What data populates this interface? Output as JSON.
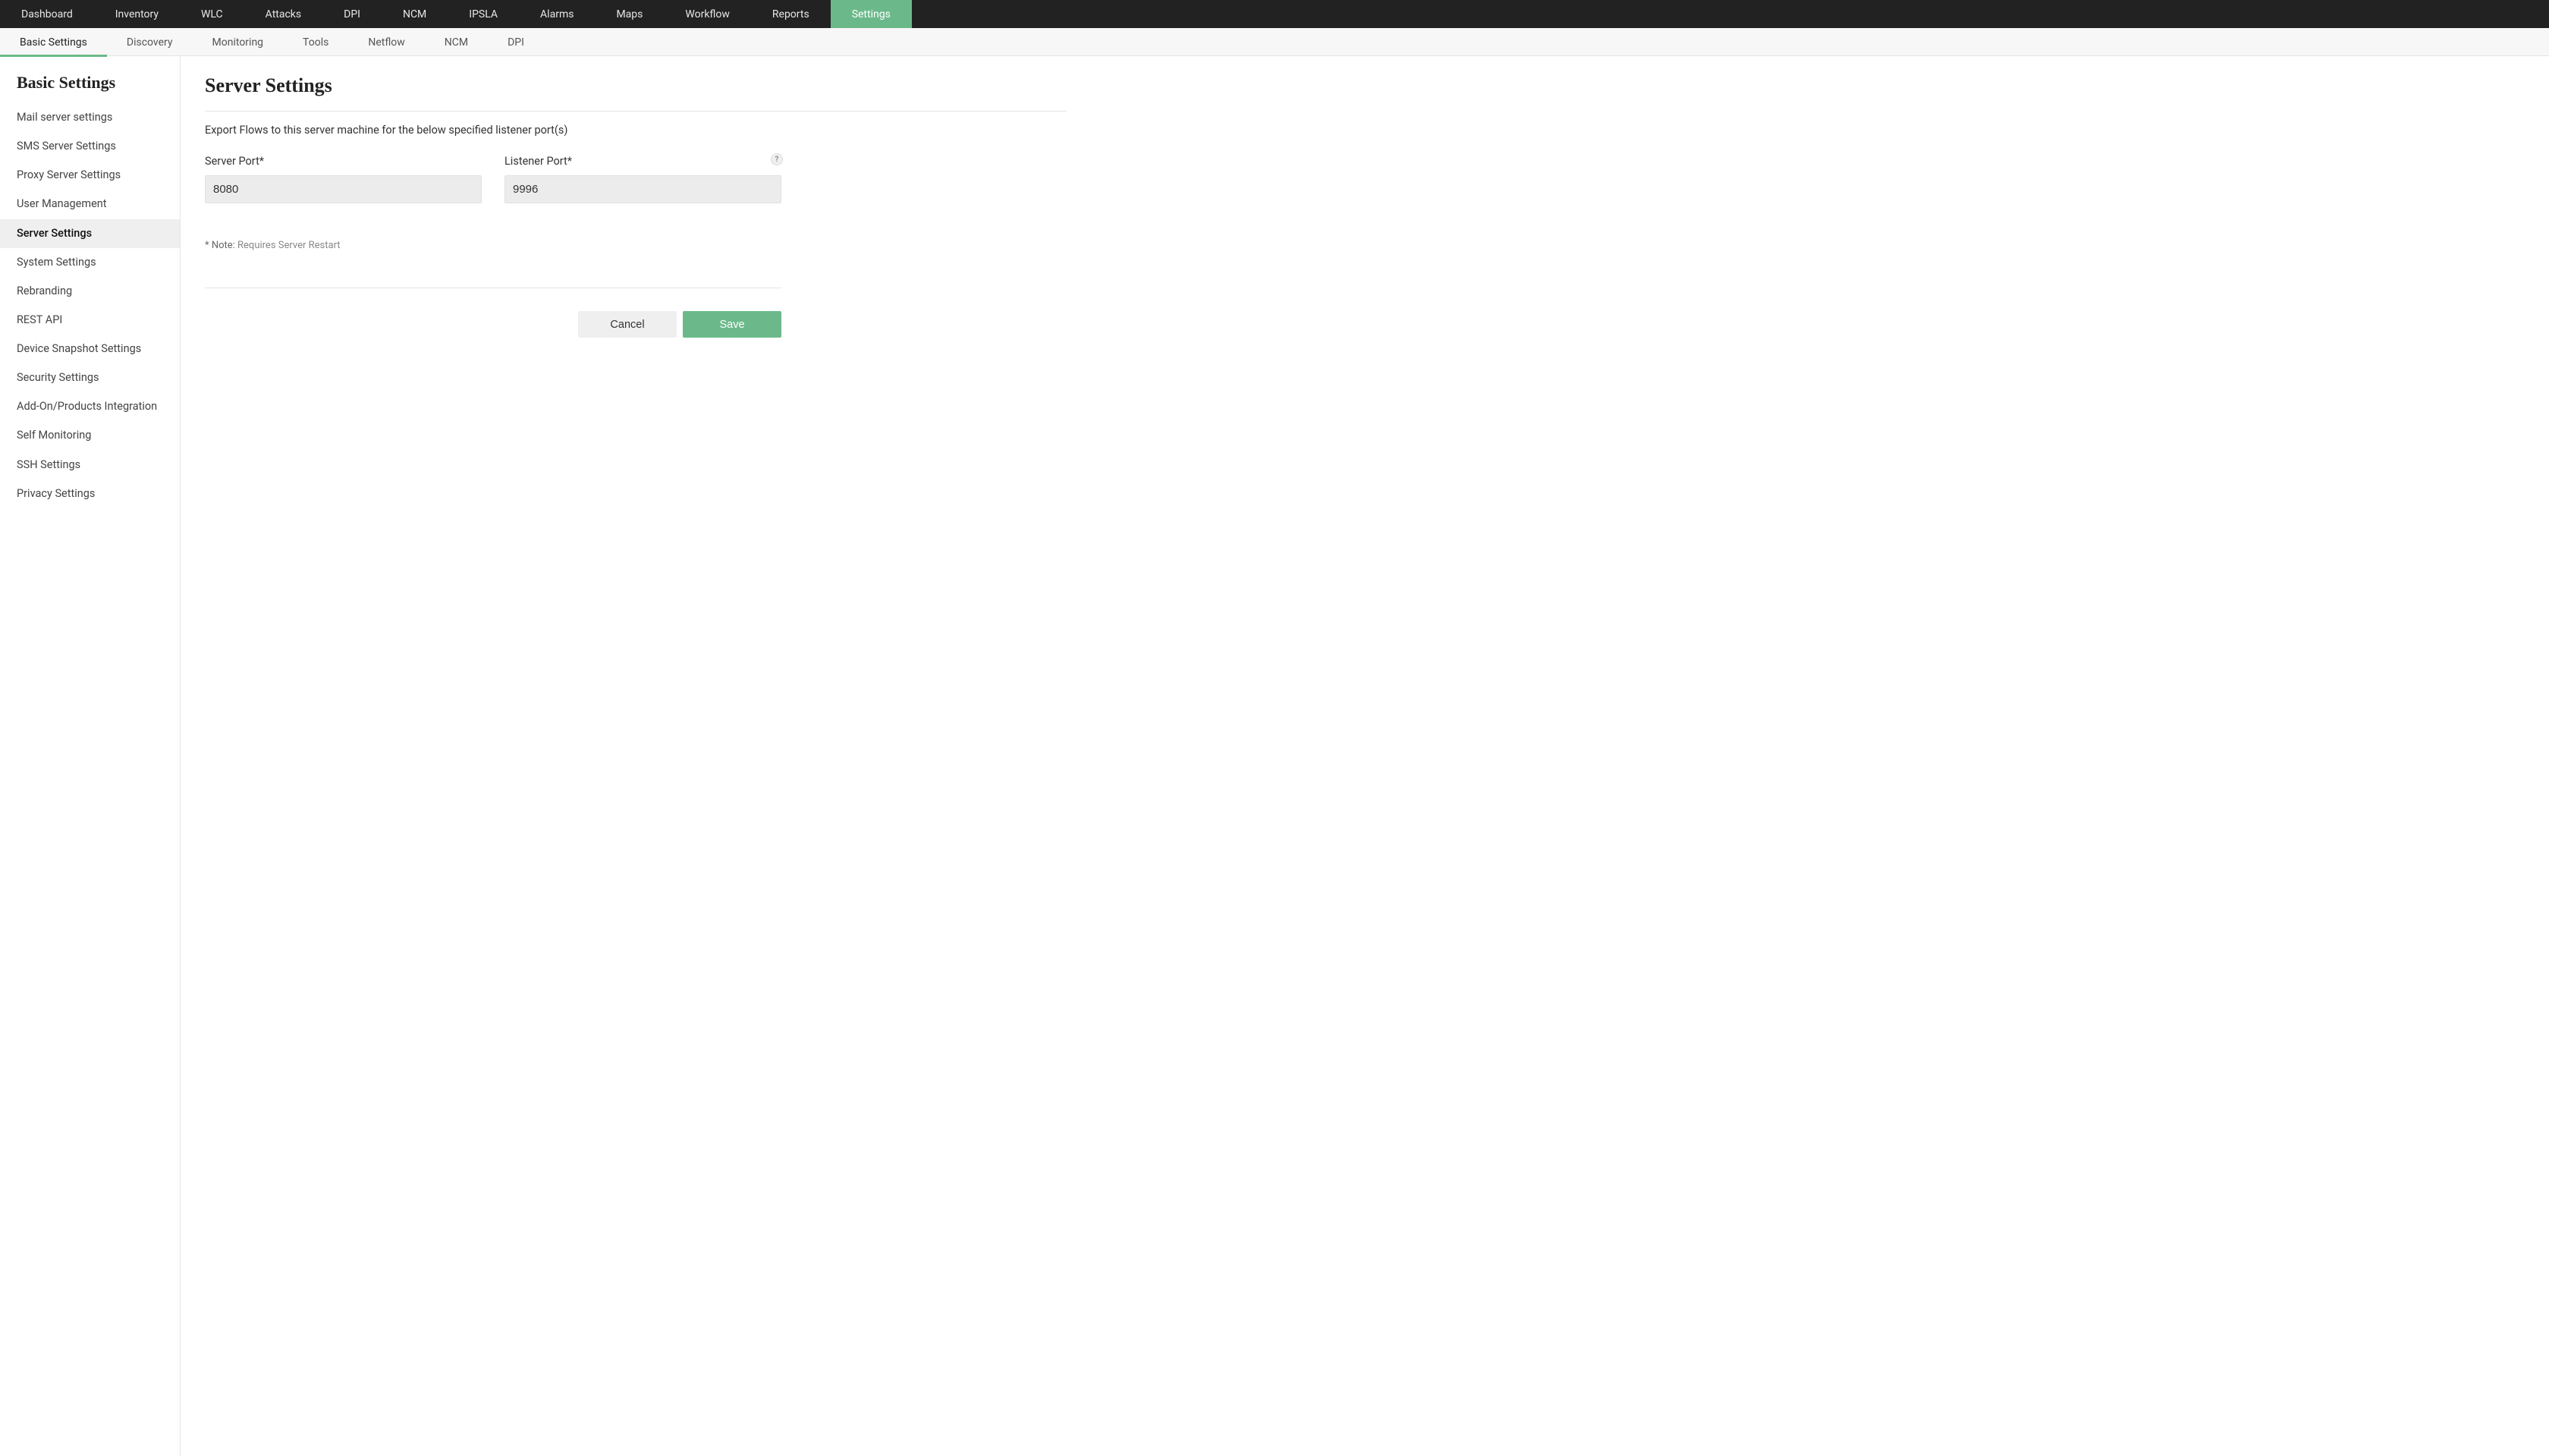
{
  "topnav": {
    "items": [
      {
        "label": "Dashboard"
      },
      {
        "label": "Inventory"
      },
      {
        "label": "WLC"
      },
      {
        "label": "Attacks"
      },
      {
        "label": "DPI"
      },
      {
        "label": "NCM"
      },
      {
        "label": "IPSLA"
      },
      {
        "label": "Alarms"
      },
      {
        "label": "Maps"
      },
      {
        "label": "Workflow"
      },
      {
        "label": "Reports"
      },
      {
        "label": "Settings"
      }
    ],
    "active_index": 11
  },
  "subnav": {
    "items": [
      {
        "label": "Basic Settings"
      },
      {
        "label": "Discovery"
      },
      {
        "label": "Monitoring"
      },
      {
        "label": "Tools"
      },
      {
        "label": "Netflow"
      },
      {
        "label": "NCM"
      },
      {
        "label": "DPI"
      }
    ],
    "active_index": 0
  },
  "sidebar": {
    "title": "Basic Settings",
    "items": [
      {
        "label": "Mail server settings"
      },
      {
        "label": "SMS Server Settings"
      },
      {
        "label": "Proxy Server Settings"
      },
      {
        "label": "User Management"
      },
      {
        "label": "Server Settings"
      },
      {
        "label": "System Settings"
      },
      {
        "label": "Rebranding"
      },
      {
        "label": "REST API"
      },
      {
        "label": "Device Snapshot Settings"
      },
      {
        "label": "Security Settings"
      },
      {
        "label": "Add-On/Products Integration"
      },
      {
        "label": "Self Monitoring"
      },
      {
        "label": "SSH Settings"
      },
      {
        "label": "Privacy Settings"
      }
    ],
    "active_index": 4
  },
  "main": {
    "title": "Server Settings",
    "description": "Export Flows to this server machine for the below specified listener port(s)",
    "fields": {
      "server_port": {
        "label": "Server Port*",
        "value": "8080"
      },
      "listener_port": {
        "label": "Listener Port*",
        "value": "9996",
        "help": "?"
      }
    },
    "note_prefix": "* Note: ",
    "note_text": "Requires Server Restart",
    "buttons": {
      "cancel": "Cancel",
      "save": "Save"
    }
  }
}
